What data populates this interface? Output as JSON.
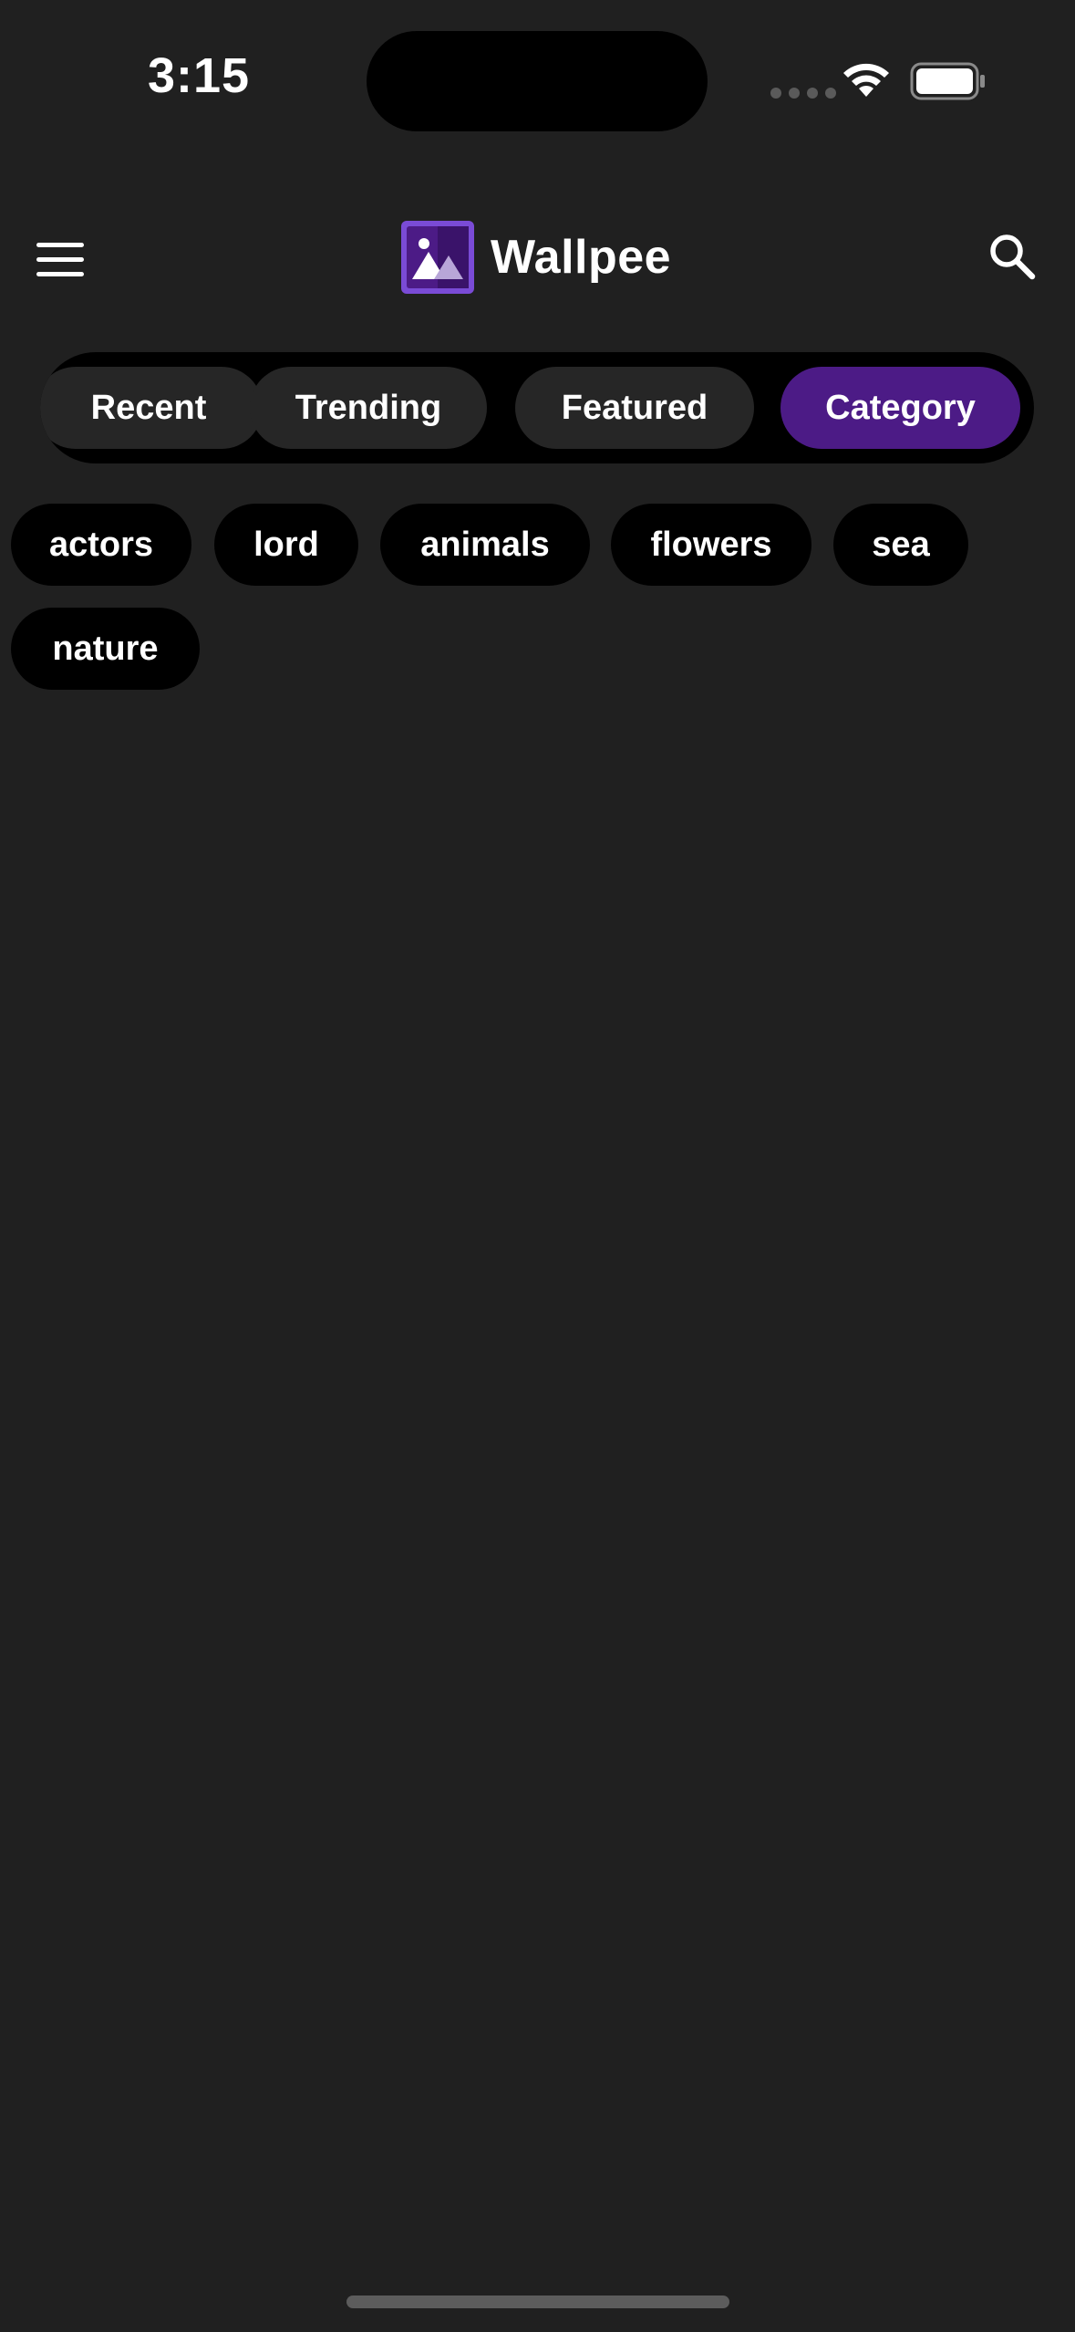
{
  "status_bar": {
    "time": "3:15"
  },
  "header": {
    "title": "Wallpee",
    "logo_icon": "image-gallery-icon",
    "menu_icon": "hamburger-menu-icon",
    "search_icon": "search-icon"
  },
  "tabs": [
    {
      "label": "Recent",
      "active": false
    },
    {
      "label": "Trending",
      "active": false
    },
    {
      "label": "Featured",
      "active": false
    },
    {
      "label": "Category",
      "active": true
    }
  ],
  "categories": [
    "actors",
    "lord",
    "animals",
    "flowers",
    "sea",
    "nature"
  ],
  "colors": {
    "background": "#202020",
    "accent": "#4c1b86",
    "tab_bg": "#262626",
    "chip_bg": "#000000"
  }
}
